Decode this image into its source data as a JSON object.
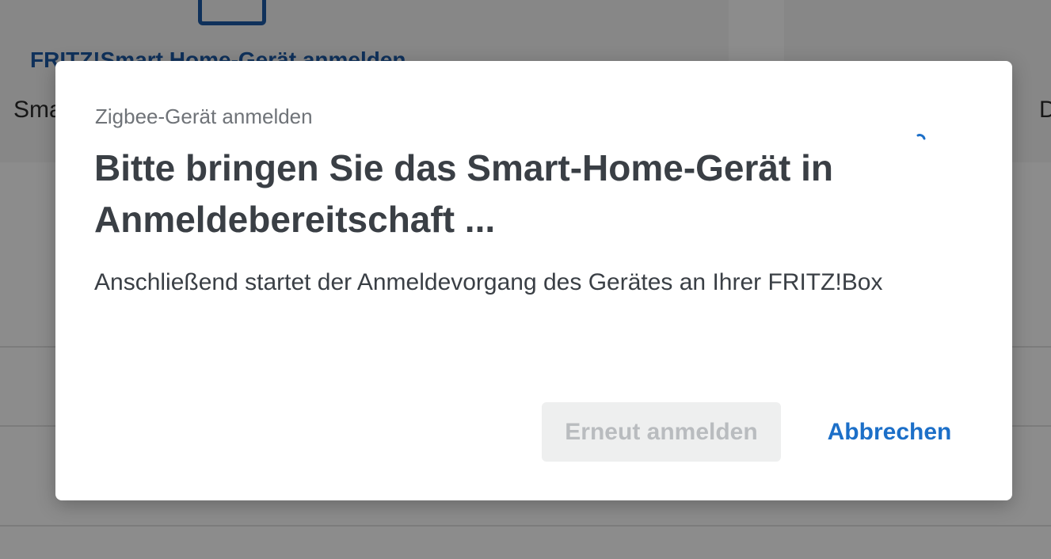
{
  "background": {
    "card_link_label": "FRITZ!Smart Home-Gerät anmelden",
    "card_desc_left": "Sma",
    "card_desc_right": "D"
  },
  "dialog": {
    "kicker": "Zigbee-Gerät anmelden",
    "title": "Bitte bringen Sie das Smart-Home-Gerät in Anmeldebereitschaft ...",
    "body": "Anschließend startet der Anmeldevorgang des Gerätes an Ihrer FRITZ!Box",
    "retry_label": "Erneut anmelden",
    "retry_disabled": true,
    "cancel_label": "Abbrechen"
  },
  "colors": {
    "accent": "#1c6fc8",
    "brand_blue": "#1c5aa6",
    "text_primary": "#3a3f45",
    "text_muted": "#6f7378",
    "disabled_bg": "#eeefef",
    "disabled_text": "#b9bcbf"
  },
  "icons": {
    "device": "smart-home-device-icon",
    "spinner": "loading-spinner-icon"
  }
}
